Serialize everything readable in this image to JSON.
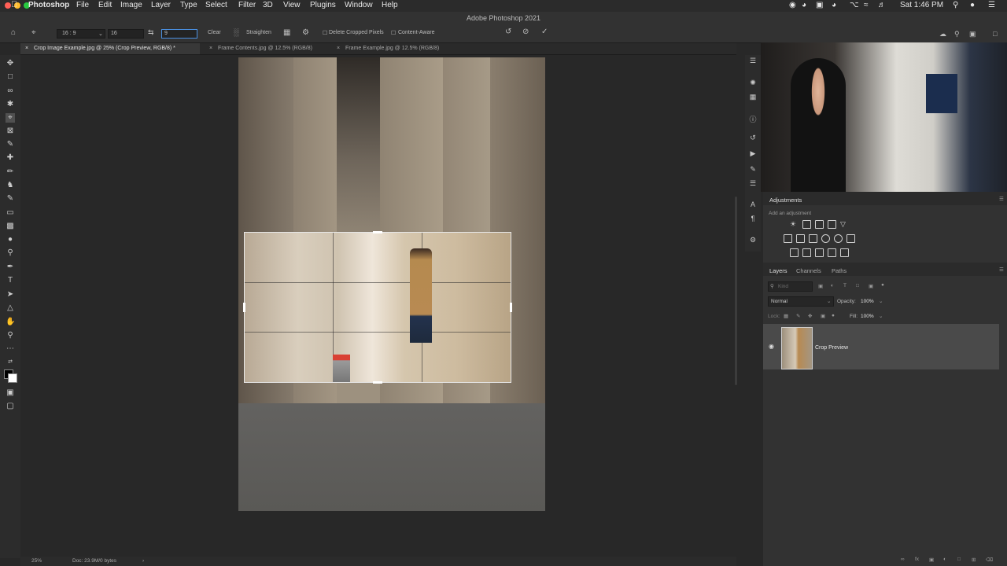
{
  "menubar": {
    "app": "Photoshop",
    "items": [
      "File",
      "Edit",
      "Image",
      "Layer",
      "Type",
      "Select",
      "Filter",
      "3D",
      "View",
      "Plugins",
      "Window",
      "Help"
    ],
    "clock": "Sat 1:46 PM"
  },
  "window_title": "Adobe Photoshop 2021",
  "options": {
    "ratio_label": "16 : 9",
    "width_value": "16",
    "height_value": "9",
    "clear": "Clear",
    "straighten": "Straighten",
    "delete_cropped": "Delete Cropped Pixels",
    "content_aware": "Content-Aware"
  },
  "tabs": [
    {
      "label": "Crop Image Example.jpg @ 25% (Crop Preview, RGB/8) *"
    },
    {
      "label": "Frame Contents.jpg @ 12.5% (RGB/8)"
    },
    {
      "label": "Frame Example.jpg @ 12.5% (RGB/8)"
    }
  ],
  "adjustments": {
    "title": "Adjustments",
    "subtitle": "Add an adjustment"
  },
  "layers_panel": {
    "tabs": [
      "Layers",
      "Channels",
      "Paths"
    ],
    "kind_placeholder": "Kind",
    "blend_mode": "Normal",
    "opacity_label": "Opacity:",
    "opacity_value": "100%",
    "lock_label": "Lock:",
    "fill_label": "Fill:",
    "fill_value": "100%",
    "layer_name": "Crop Preview"
  },
  "status": {
    "zoom": "25%",
    "doc": "Doc: 23.9M/0 bytes"
  },
  "colors": {
    "accent": "#4a90e2",
    "crop_frame": "#e6e6e6"
  }
}
